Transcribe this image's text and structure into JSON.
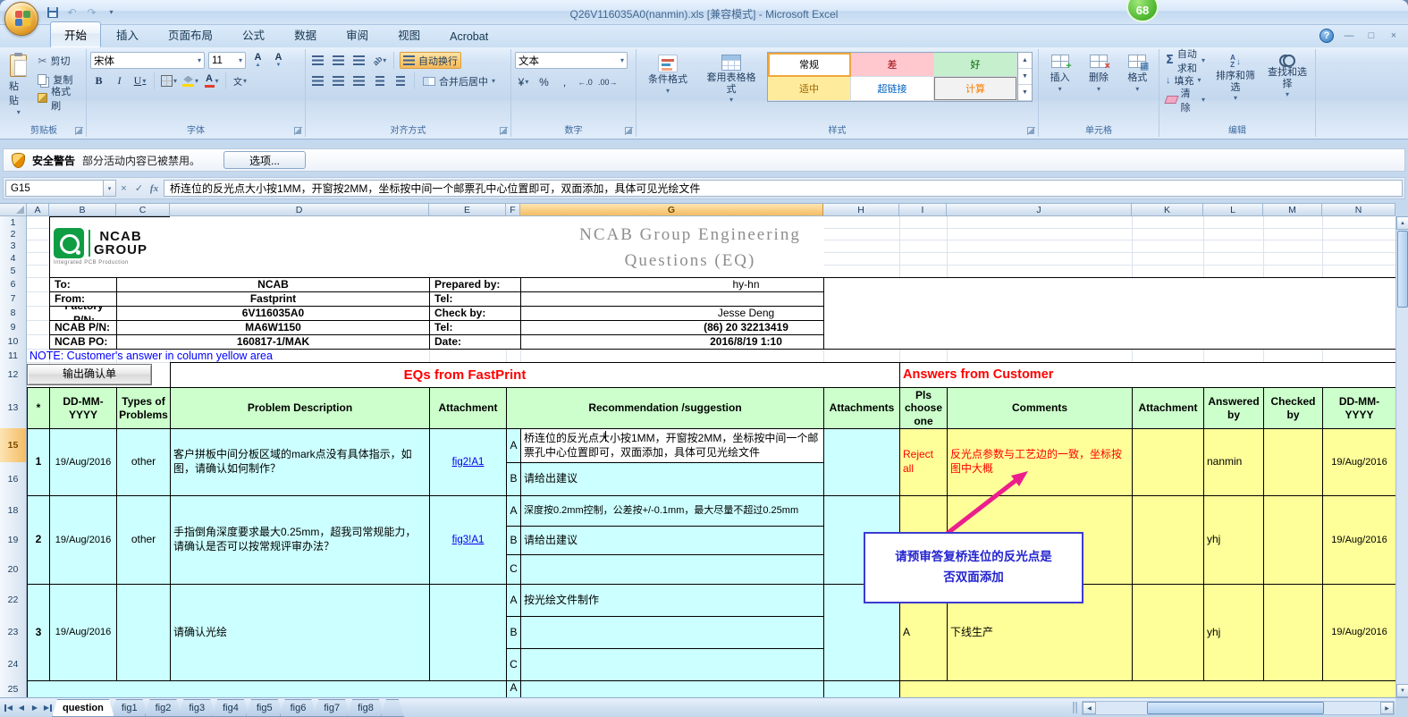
{
  "window": {
    "title": "Q26V116035A0(nanmin).xls  [兼容模式] - Microsoft Excel",
    "badge": "68",
    "controls": {
      "help": "?",
      "minimize": "—",
      "restore": "□",
      "close": "×"
    }
  },
  "icons": {
    "dropdown": "▾",
    "undo": "↶",
    "redo": "↷",
    "cancel": "×",
    "enter": "✓",
    "fx": "fx",
    "up": "▲",
    "down": "▼",
    "left": "◀",
    "right": "▶",
    "scissors": "✂",
    "sigma": "Σ",
    "fill_down": "↓",
    "currency": "¥",
    "percent": "%",
    "comma": ",",
    "inc_decimal": "←.0",
    "dec_decimal": ".00→"
  },
  "ribbon": {
    "tabs": [
      {
        "name": "home",
        "label": "开始",
        "active": true
      },
      {
        "name": "insert",
        "label": "插入"
      },
      {
        "name": "page-layout",
        "label": "页面布局"
      },
      {
        "name": "formulas",
        "label": "公式"
      },
      {
        "name": "data",
        "label": "数据"
      },
      {
        "name": "review",
        "label": "审阅"
      },
      {
        "name": "view",
        "label": "视图"
      },
      {
        "name": "acrobat",
        "label": "Acrobat"
      }
    ],
    "clipboard": {
      "title": "剪贴板",
      "paste": "粘贴",
      "cut": "剪切",
      "copy": "复制",
      "format_painter": "格式刷"
    },
    "font": {
      "title": "字体",
      "family": "宋体",
      "size": "11",
      "bold": "B",
      "italic": "I",
      "underline": "U",
      "phonetic": "文"
    },
    "alignment": {
      "title": "对齐方式",
      "wrap_text": "自动换行",
      "merge_center": "合并后居中",
      "orient": "ab"
    },
    "number": {
      "title": "数字",
      "format": "文本"
    },
    "styles": {
      "title": "样式",
      "conditional": "条件格式",
      "format_table": "套用表格格式",
      "cell_styles": [
        {
          "name": "normal",
          "label": "常规"
        },
        {
          "name": "bad",
          "label": "差"
        },
        {
          "name": "good",
          "label": "好"
        },
        {
          "name": "neutral",
          "label": "适中"
        },
        {
          "name": "hyperlink",
          "label": "超链接"
        },
        {
          "name": "calculation",
          "label": "计算"
        }
      ]
    },
    "cells_group": {
      "title": "单元格",
      "insert": "插入",
      "delete": "删除",
      "format": "格式"
    },
    "editing": {
      "title": "编辑",
      "autosum": "自动求和",
      "fill": "填充",
      "clear": "清除",
      "sort_filter": "排序和筛选",
      "find_select": "查找和选择"
    }
  },
  "security_bar": {
    "label": "安全警告",
    "message": "部分活动内容已被禁用。",
    "options_button": "选项..."
  },
  "formula_bar": {
    "name_box": "G15",
    "formula": "桥连位的反光点大小按1MM，开窗按2MM，坐标按中间一个邮票孔中心位置即可，双面添加，具体可见光绘文件"
  },
  "grid": {
    "columns": [
      "A",
      "B",
      "C",
      "D",
      "E",
      "F",
      "G",
      "H",
      "I",
      "J",
      "K",
      "L",
      "M",
      "N"
    ],
    "active_column": "G",
    "active_row": 15,
    "row_numbers": [
      1,
      2,
      3,
      4,
      5,
      6,
      7,
      8,
      9,
      10,
      11,
      12,
      13,
      15,
      16,
      18,
      19,
      20,
      22,
      23,
      24,
      25
    ],
    "logo": {
      "line1": "NCAB",
      "line2": "GROUP",
      "tagline": "Integrated PCB Production"
    },
    "title_line1": "NCAB Group Engineering",
    "title_line2": "Questions (EQ)",
    "cells": [
      {
        "n": "empty-box",
        "c": "H",
        "c2": "N",
        "r": 6,
        "r2": 10,
        "t": "",
        "s": "bd"
      },
      {
        "n": "company-logo",
        "c": "B",
        "c2": "C",
        "r": 1,
        "r2": 5,
        "t": "",
        "s": "bd logo"
      },
      {
        "n": "doc-title",
        "c": "D",
        "c2": "G",
        "r": 1,
        "r2": 5,
        "t": "",
        "s": "title"
      },
      {
        "n": "to-label",
        "c": "B",
        "r": 6,
        "t": "To:",
        "s": "bd bold lbl"
      },
      {
        "n": "to-value",
        "c": "C",
        "c2": "D",
        "r": 6,
        "t": "NCAB",
        "s": "bd bold"
      },
      {
        "n": "prepared-by-label",
        "c": "E",
        "c2": "F",
        "r": 6,
        "t": "Prepared by:",
        "s": "bd bold lbl"
      },
      {
        "n": "prepared-by-value",
        "c": "G",
        "r": 6,
        "t": "hy-hn",
        "s": "bd rv"
      },
      {
        "n": "from-label",
        "c": "B",
        "r": 7,
        "t": "From:",
        "s": "bd bold lbl"
      },
      {
        "n": "from-value",
        "c": "C",
        "c2": "D",
        "r": 7,
        "t": "Fastprint",
        "s": "bd bold"
      },
      {
        "n": "tel1-label",
        "c": "E",
        "c2": "F",
        "r": 7,
        "t": "Tel:",
        "s": "bd bold lbl"
      },
      {
        "n": "tel1-value",
        "c": "G",
        "r": 7,
        "t": "",
        "s": "bd"
      },
      {
        "n": "factory-pn-label",
        "c": "B",
        "r": 8,
        "t": "Factory P/N:",
        "s": "bd bold lbl"
      },
      {
        "n": "factory-pn-value",
        "c": "C",
        "c2": "D",
        "r": 8,
        "t": "6V116035A0",
        "s": "bd bold"
      },
      {
        "n": "check-by-label",
        "c": "E",
        "c2": "F",
        "r": 8,
        "t": "Check by:",
        "s": "bd bold lbl"
      },
      {
        "n": "check-by-value",
        "c": "G",
        "r": 8,
        "t": "Jesse Deng",
        "s": "bd rv"
      },
      {
        "n": "ncab-pn-label",
        "c": "B",
        "r": 9,
        "t": "NCAB P/N:",
        "s": "bd bold lbl"
      },
      {
        "n": "ncab-pn-value",
        "c": "C",
        "c2": "D",
        "r": 9,
        "t": "MA6W1150",
        "s": "bd bold"
      },
      {
        "n": "tel2-label",
        "c": "E",
        "c2": "F",
        "r": 9,
        "t": "Tel:",
        "s": "bd bold lbl"
      },
      {
        "n": "tel2-value",
        "c": "G",
        "r": 9,
        "t": "(86) 20 32213419",
        "s": "bd bold rv"
      },
      {
        "n": "ncab-po-label",
        "c": "B",
        "r": 10,
        "t": "NCAB PO:",
        "s": "bd bold lbl"
      },
      {
        "n": "ncab-po-value",
        "c": "C",
        "c2": "D",
        "r": 10,
        "t": "160817-1/MAK",
        "s": "bd bold"
      },
      {
        "n": "date-label",
        "c": "E",
        "c2": "F",
        "r": 10,
        "t": "Date:",
        "s": "bd bold lbl"
      },
      {
        "n": "date-value",
        "c": "G",
        "r": 10,
        "t": "2016/8/19 1:10",
        "s": "bd bold rv"
      },
      {
        "n": "note-row",
        "c": "A",
        "c2": "G",
        "r": 11,
        "t": "NOTE: Customer's answer in column yellow area",
        "s": "note"
      },
      {
        "n": "export-confirm-button",
        "c": "A",
        "c2": "C",
        "r": 12,
        "t": "输出确认单",
        "s": "formbtn"
      },
      {
        "n": "section-eq",
        "c": "D",
        "c2": "H",
        "r": 12,
        "t": "EQs from FastPrint",
        "s": "bd section"
      },
      {
        "n": "section-answers",
        "c": "I",
        "c2": "N",
        "r": 12,
        "t": "Answers from Customer",
        "s": "bd section-l"
      },
      {
        "n": "th-star",
        "c": "A",
        "r": 13,
        "t": "*",
        "s": "bd green th"
      },
      {
        "n": "th-date1",
        "c": "B",
        "r": 13,
        "t": "DD-MM-\nYYYY",
        "s": "bd green th"
      },
      {
        "n": "th-types",
        "c": "C",
        "r": 13,
        "t": "Types of\nProblems",
        "s": "bd green th"
      },
      {
        "n": "th-problem",
        "c": "D",
        "r": 13,
        "t": "Problem Description",
        "s": "bd green th"
      },
      {
        "n": "th-attachment1",
        "c": "E",
        "r": 13,
        "t": "Attachment",
        "s": "bd green th"
      },
      {
        "n": "th-recommendation",
        "c": "F",
        "c2": "G",
        "r": 13,
        "t": "Recommendation /suggestion",
        "s": "bd green th"
      },
      {
        "n": "th-attachments",
        "c": "H",
        "r": 13,
        "t": "Attachments",
        "s": "bd green th"
      },
      {
        "n": "th-choose",
        "c": "I",
        "r": 13,
        "t": "Pls\nchoose\none",
        "s": "bd green th"
      },
      {
        "n": "th-comments",
        "c": "J",
        "r": 13,
        "t": "Comments",
        "s": "bd green th"
      },
      {
        "n": "th-attachment2",
        "c": "K",
        "r": 13,
        "t": "Attachment",
        "s": "bd green th"
      },
      {
        "n": "th-answered-by",
        "c": "L",
        "r": 13,
        "t": "Answered\nby",
        "s": "bd green th"
      },
      {
        "n": "th-checked-by",
        "c": "M",
        "r": 13,
        "t": "Checked\nby",
        "s": "bd green th"
      },
      {
        "n": "th-date2",
        "c": "N",
        "r": 13,
        "t": "DD-MM-YYYY",
        "s": "bd green th"
      },
      {
        "n": "r1-num",
        "c": "A",
        "r": 15,
        "r2": 16,
        "t": "1",
        "s": "bd cyan bold"
      },
      {
        "n": "r1-date",
        "c": "B",
        "r": 15,
        "r2": 16,
        "t": "19/Aug/2016",
        "s": "bd cyan small"
      },
      {
        "n": "r1-type",
        "c": "C",
        "r": 15,
        "r2": 16,
        "t": "other",
        "s": "bd cyan"
      },
      {
        "n": "r1-problem",
        "c": "D",
        "r": 15,
        "r2": 16,
        "t": "客户拼板中间分板区域的mark点没有具体指示，如图，请确认如何制作？",
        "s": "bd cyan left"
      },
      {
        "n": "r1-attachment-link",
        "c": "E",
        "r": 15,
        "r2": 16,
        "t": "fig2!A1",
        "s": "bd cyan link"
      },
      {
        "n": "r1a-tag",
        "c": "F",
        "r": 15,
        "t": "A",
        "s": "bd cyan"
      },
      {
        "n": "r1a-suggestion",
        "c": "G",
        "r": 15,
        "t": "桥连位的反光点大小按1MM，开窗按2MM，坐标按中间一个邮票孔中心位置即可，双面添加，具体可见光绘文件",
        "s": "bd left edit"
      },
      {
        "n": "r1b-tag",
        "c": "F",
        "r": 16,
        "t": "B",
        "s": "bd cyan"
      },
      {
        "n": "r1b-suggestion",
        "c": "G",
        "r": 16,
        "t": "请给出建议",
        "s": "bd cyan left"
      },
      {
        "n": "r1-attachments",
        "c": "H",
        "r": 15,
        "r2": 16,
        "t": "",
        "s": "bd cyan"
      },
      {
        "n": "r1-choose",
        "c": "I",
        "r": 15,
        "r2": 16,
        "t": "Reject all",
        "s": "bd yellow red left"
      },
      {
        "n": "r1-comments",
        "c": "J",
        "r": 15,
        "r2": 16,
        "t": "反光点参数与工艺边的一致，坐标按图中大概",
        "s": "bd yellow red left"
      },
      {
        "n": "r1-attachment2",
        "c": "K",
        "r": 15,
        "r2": 16,
        "t": "",
        "s": "bd yellow"
      },
      {
        "n": "r1-answered",
        "c": "L",
        "r": 15,
        "r2": 16,
        "t": "nanmin",
        "s": "bd yellow left"
      },
      {
        "n": "r1-checked",
        "c": "M",
        "r": 15,
        "r2": 16,
        "t": "",
        "s": "bd yellow"
      },
      {
        "n": "r1-date2",
        "c": "N",
        "r": 15,
        "r2": 16,
        "t": "19/Aug/2016",
        "s": "bd yellow small"
      },
      {
        "n": "r2-num",
        "c": "A",
        "r": 18,
        "r2": 20,
        "t": "2",
        "s": "bd cyan bold"
      },
      {
        "n": "r2-date",
        "c": "B",
        "r": 18,
        "r2": 20,
        "t": "19/Aug/2016",
        "s": "bd cyan small"
      },
      {
        "n": "r2-type",
        "c": "C",
        "r": 18,
        "r2": 20,
        "t": "other",
        "s": "bd cyan"
      },
      {
        "n": "r2-problem",
        "c": "D",
        "r": 18,
        "r2": 20,
        "t": "手指倒角深度要求最大0.25mm，超我司常规能力，请确认是否可以按常规评审办法？",
        "s": "bd cyan left"
      },
      {
        "n": "r2-attachment-link",
        "c": "E",
        "r": 18,
        "r2": 20,
        "t": "fig3!A1",
        "s": "bd cyan link"
      },
      {
        "n": "r2a-tag",
        "c": "F",
        "r": 18,
        "t": "A",
        "s": "bd cyan"
      },
      {
        "n": "r2a-suggestion",
        "c": "G",
        "r": 18,
        "t": "深度按0.2mm控制，公差按+/-0.1mm，最大尽量不超过0.25mm",
        "s": "bd cyan left small nowrap"
      },
      {
        "n": "r2b-tag",
        "c": "F",
        "r": 19,
        "t": "B",
        "s": "bd cyan"
      },
      {
        "n": "r2b-suggestion",
        "c": "G",
        "r": 19,
        "t": "请给出建议",
        "s": "bd cyan left"
      },
      {
        "n": "r2c-tag",
        "c": "F",
        "r": 20,
        "t": "C",
        "s": "bd cyan"
      },
      {
        "n": "r2c-suggestion",
        "c": "G",
        "r": 20,
        "t": "",
        "s": "bd cyan"
      },
      {
        "n": "r2-attachments",
        "c": "H",
        "r": 18,
        "r2": 20,
        "t": "",
        "s": "bd cyan"
      },
      {
        "n": "r2-choose",
        "c": "I",
        "r": 18,
        "r2": 20,
        "t": "",
        "s": "bd yellow"
      },
      {
        "n": "r2-comments",
        "c": "J",
        "r": 18,
        "r2": 20,
        "t": "",
        "s": "bd yellow"
      },
      {
        "n": "r2-attachment2",
        "c": "K",
        "r": 18,
        "r2": 20,
        "t": "",
        "s": "bd yellow"
      },
      {
        "n": "r2-answered",
        "c": "L",
        "r": 18,
        "r2": 20,
        "t": "yhj",
        "s": "bd yellow left"
      },
      {
        "n": "r2-checked",
        "c": "M",
        "r": 18,
        "r2": 20,
        "t": "",
        "s": "bd yellow"
      },
      {
        "n": "r2-date2",
        "c": "N",
        "r": 18,
        "r2": 20,
        "t": "19/Aug/2016",
        "s": "bd yellow small"
      },
      {
        "n": "r3-num",
        "c": "A",
        "r": 22,
        "r2": 24,
        "t": "3",
        "s": "bd cyan bold"
      },
      {
        "n": "r3-date",
        "c": "B",
        "r": 22,
        "r2": 24,
        "t": "19/Aug/2016",
        "s": "bd cyan small"
      },
      {
        "n": "r3-type",
        "c": "C",
        "r": 22,
        "r2": 24,
        "t": "",
        "s": "bd cyan"
      },
      {
        "n": "r3-problem",
        "c": "D",
        "r": 22,
        "r2": 24,
        "t": "请确认光绘",
        "s": "bd cyan left"
      },
      {
        "n": "r3-attachment-link",
        "c": "E",
        "r": 22,
        "r2": 24,
        "t": "",
        "s": "bd cyan"
      },
      {
        "n": "r3a-tag",
        "c": "F",
        "r": 22,
        "t": "A",
        "s": "bd cyan"
      },
      {
        "n": "r3a-suggestion",
        "c": "G",
        "r": 22,
        "t": "按光绘文件制作",
        "s": "bd cyan left"
      },
      {
        "n": "r3b-tag",
        "c": "F",
        "r": 23,
        "t": "B",
        "s": "bd cyan"
      },
      {
        "n": "r3b-suggestion",
        "c": "G",
        "r": 23,
        "t": "",
        "s": "bd cyan"
      },
      {
        "n": "r3c-tag",
        "c": "F",
        "r": 24,
        "t": "C",
        "s": "bd cyan"
      },
      {
        "n": "r3c-suggestion",
        "c": "G",
        "r": 24,
        "t": "",
        "s": "bd cyan"
      },
      {
        "n": "r3-attachments",
        "c": "H",
        "r": 22,
        "r2": 24,
        "t": "",
        "s": "bd cyan"
      },
      {
        "n": "r3-choose",
        "c": "I",
        "r": 22,
        "r2": 24,
        "t": "A",
        "s": "bd yellow left"
      },
      {
        "n": "r3-comments",
        "c": "J",
        "r": 22,
        "r2": 24,
        "t": "下线生产",
        "s": "bd yellow left"
      },
      {
        "n": "r3-attachment2",
        "c": "K",
        "r": 22,
        "r2": 24,
        "t": "",
        "s": "bd yellow"
      },
      {
        "n": "r3-answered",
        "c": "L",
        "r": 22,
        "r2": 24,
        "t": "yhj",
        "s": "bd yellow left"
      },
      {
        "n": "r3-checked",
        "c": "M",
        "r": 22,
        "r2": 24,
        "t": "",
        "s": "bd yellow"
      },
      {
        "n": "r3-date2",
        "c": "N",
        "r": 22,
        "r2": 24,
        "t": "19/Aug/2016",
        "s": "bd yellow small"
      },
      {
        "n": "r4-left",
        "c": "A",
        "c2": "E",
        "r": 25,
        "t": "",
        "s": "bd cyan"
      },
      {
        "n": "r4a-tag",
        "c": "F",
        "r": 25,
        "t": "A",
        "s": "bd cyan top"
      },
      {
        "n": "r4a-suggestion",
        "c": "G",
        "r": 25,
        "t": "",
        "s": "bd cyan"
      },
      {
        "n": "r4-attachments",
        "c": "H",
        "r": 25,
        "t": "",
        "s": "bd cyan"
      },
      {
        "n": "r4-right",
        "c": "I",
        "c2": "N",
        "r": 25,
        "t": "",
        "s": "bd yellow"
      }
    ]
  },
  "annotation": {
    "line1": "请预审答复桥连位的反光点是",
    "line2": "否双面添加"
  },
  "sheet_tabs": [
    {
      "name": "question",
      "label": "question",
      "active": true
    },
    {
      "name": "fig1",
      "label": "fig1"
    },
    {
      "name": "fig2",
      "label": "fig2"
    },
    {
      "name": "fig3",
      "label": "fig3"
    },
    {
      "name": "fig4",
      "label": "fig4"
    },
    {
      "name": "fig5",
      "label": "fig5"
    },
    {
      "name": "fig6",
      "label": "fig6"
    },
    {
      "name": "fig7",
      "label": "fig7"
    },
    {
      "name": "fig8",
      "label": "fig8"
    }
  ]
}
